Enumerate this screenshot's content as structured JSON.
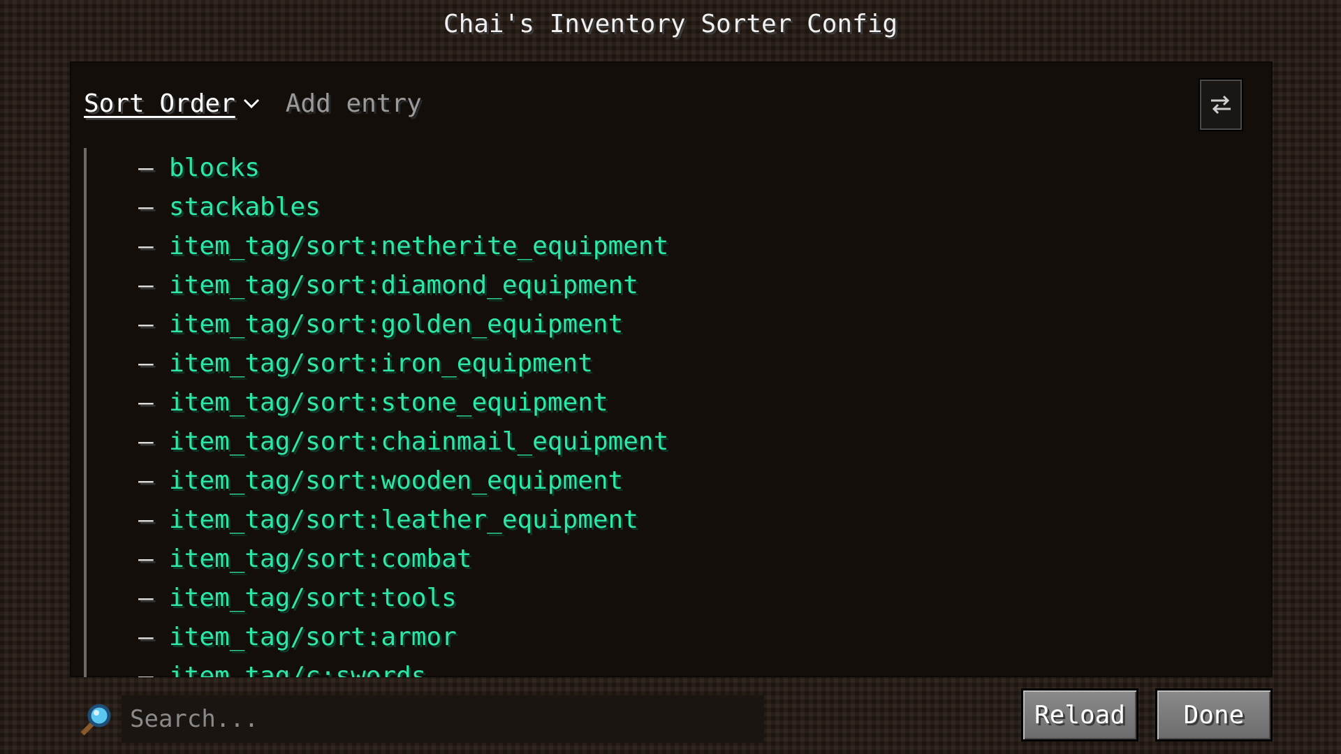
{
  "window": {
    "title": "Chai's Inventory Sorter Config"
  },
  "toolbar": {
    "sort_order_label": "Sort Order",
    "add_entry_label": "Add entry",
    "swap_icon": "swap-arrows-icon"
  },
  "entries": [
    "blocks",
    "stackables",
    "item_tag/sort:netherite_equipment",
    "item_tag/sort:diamond_equipment",
    "item_tag/sort:golden_equipment",
    "item_tag/sort:iron_equipment",
    "item_tag/sort:stone_equipment",
    "item_tag/sort:chainmail_equipment",
    "item_tag/sort:wooden_equipment",
    "item_tag/sort:leather_equipment",
    "item_tag/sort:combat",
    "item_tag/sort:tools",
    "item_tag/sort:armor",
    "item_tag/c:swords"
  ],
  "entry_prefix": "–",
  "search": {
    "placeholder": "Search...",
    "value": ""
  },
  "buttons": {
    "reload_label": "Reload",
    "done_label": "Done"
  },
  "colors": {
    "entry_text": "#2ee6a6",
    "panel": "#140e0a"
  }
}
